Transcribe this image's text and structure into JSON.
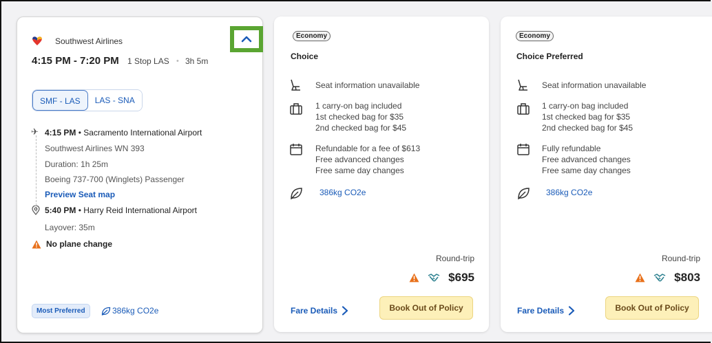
{
  "flight": {
    "airline": "Southwest Airlines",
    "time_range": "4:15 PM - 7:20 PM",
    "stops": "1 Stop LAS",
    "duration": "3h 5m",
    "segments": [
      {
        "label": "SMF - LAS",
        "active": true
      },
      {
        "label": "LAS - SNA",
        "active": false
      }
    ],
    "departure": {
      "time": "4:15 PM",
      "airport": "Sacramento International Airport"
    },
    "flight_number": "Southwest Airlines WN 393",
    "segment_duration": "Duration: 1h 25m",
    "aircraft": "Boeing 737-700 (Winglets) Passenger",
    "seat_map_link": "Preview Seat map",
    "arrival": {
      "time": "5:40 PM",
      "airport": "Harry Reid International Airport"
    },
    "layover": "Layover: 35m",
    "plane_change_note": "No plane change",
    "preferred_badge": "Most Preferred",
    "co2": "386kg CO2e"
  },
  "fares": [
    {
      "cabin": "Economy",
      "name": "Choice",
      "seat": "Seat information unavailable",
      "bags": [
        "1 carry-on bag included",
        "1st checked bag for $35",
        "2nd checked bag for $45"
      ],
      "changes": [
        "Refundable for a fee of $613",
        "Free advanced changes",
        "Free same day changes"
      ],
      "co2": "386kg CO2e",
      "trip_type": "Round-trip",
      "price": "$695",
      "details_label": "Fare Details",
      "book_label": "Book Out of Policy"
    },
    {
      "cabin": "Economy",
      "name": "Choice Preferred",
      "seat": "Seat information unavailable",
      "bags": [
        "1 carry-on bag included",
        "1st checked bag for $35",
        "2nd checked bag for $45"
      ],
      "changes": [
        "Fully refundable",
        "Free advanced changes",
        "Free same day changes"
      ],
      "co2": "386kg CO2e",
      "trip_type": "Round-trip",
      "price": "$803",
      "details_label": "Fare Details",
      "book_label": "Book Out of Policy"
    }
  ],
  "colors": {
    "link": "#1a5bb8",
    "warning": "#e8701a",
    "highlight_border": "#5aa532",
    "book_button": "#fdf0b9"
  }
}
